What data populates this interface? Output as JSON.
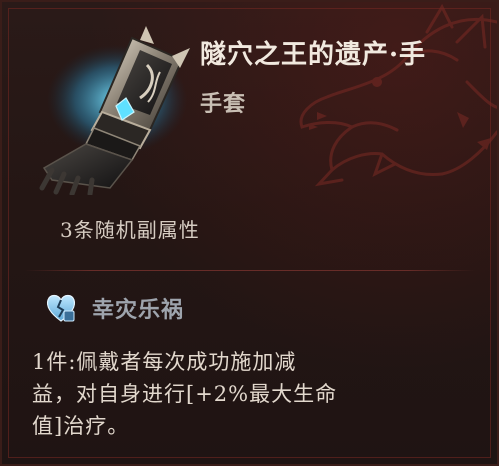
{
  "item": {
    "name": "隧穴之王的遗产·手",
    "type": "手套",
    "icon": "gauntlet-icon"
  },
  "affixes": {
    "random_count_text": "3条随机副属性"
  },
  "set": {
    "icon": "broken-heart-icon",
    "name": "幸灾乐祸",
    "bonus_lines": [
      "1件:佩戴者每次成功施加减",
      "益，对自身进行[+2%最大生命",
      "值]治疗。"
    ]
  },
  "colors": {
    "background": "#241614",
    "frame": "#3a1d19",
    "name_text": "#f1e9df",
    "set_name_text": "#9ea4ad",
    "glow_accent": "#4fd6ff",
    "dragon_tint": "#7a2a24"
  }
}
